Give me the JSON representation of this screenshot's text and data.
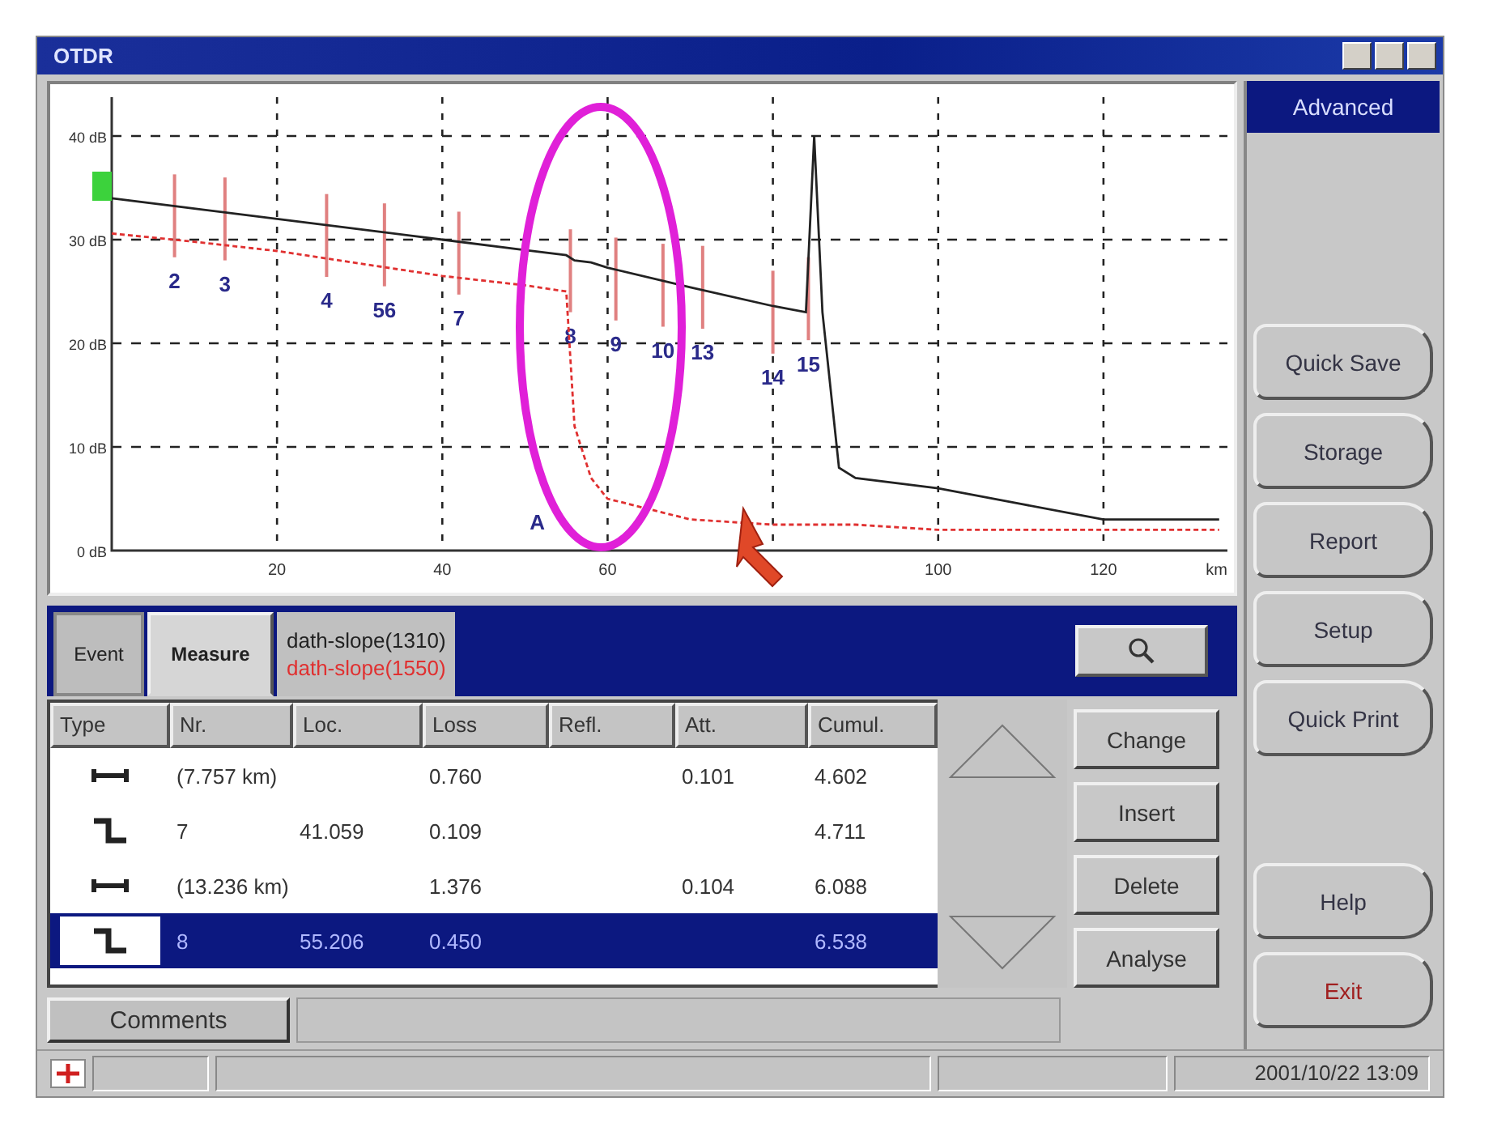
{
  "window": {
    "title": "OTDR"
  },
  "chart": {
    "chart_data": {
      "type": "line",
      "xlabel": "km",
      "grid": true,
      "x": [
        0,
        10,
        20,
        30,
        40,
        50,
        55,
        56,
        58,
        60,
        70,
        80,
        84,
        85,
        86,
        88,
        90,
        100,
        110,
        120,
        134
      ],
      "series": [
        {
          "name": "dath-slope(1310)",
          "color": "#222222",
          "line_style": "solid",
          "values": [
            34,
            33,
            32,
            31,
            30,
            29,
            28.5,
            28,
            27.8,
            27.3,
            25.4,
            23.6,
            23,
            40,
            23,
            8,
            7,
            6,
            4.5,
            3,
            3
          ]
        },
        {
          "name": "dath-slope(1550)",
          "color": "#e03030",
          "line_style": "dashed",
          "values": [
            30.6,
            29.8,
            28.9,
            27.7,
            26.5,
            25.6,
            25,
            12,
            7,
            5,
            3,
            2.5,
            2.5,
            2.5,
            2.5,
            2.5,
            2.5,
            2,
            2,
            2,
            2
          ]
        }
      ],
      "xlim": [
        0,
        135
      ],
      "ylim": [
        0,
        43.75
      ],
      "xticks": [
        20,
        40,
        60,
        100,
        120
      ],
      "yticks": [
        {
          "value": 0,
          "label": "0 dB"
        },
        {
          "value": 10,
          "label": "10 dB"
        },
        {
          "value": 20,
          "label": "20 dB"
        },
        {
          "value": 30,
          "label": "30 dB"
        },
        {
          "value": 40,
          "label": "40 dB"
        }
      ],
      "annotations": [
        "2",
        "3",
        "4",
        "56",
        "7",
        "8",
        "9",
        "10",
        "13",
        "14",
        "15",
        "A"
      ]
    }
  },
  "side_panel": {
    "title": "Advanced",
    "buttons": [
      "Quick Save",
      "Storage",
      "Report",
      "Setup",
      "Quick Print"
    ],
    "bottom_buttons": [
      "Help",
      "Exit"
    ]
  },
  "tabs": [
    {
      "label": "Event",
      "selected": false
    },
    {
      "label": "Measure",
      "selected": true
    }
  ],
  "table": {
    "columns": [
      "Type",
      "Nr.",
      "Loc.",
      "Loss",
      "Refl.",
      "Att.",
      "Cumul."
    ],
    "rows": [
      {
        "kind": "span",
        "selected": false,
        "cells": [
          "",
          "(7.757 km)",
          "",
          "0.760",
          "",
          "0.101",
          "4.602"
        ]
      },
      {
        "kind": "step",
        "selected": false,
        "cells": [
          "",
          "7",
          "41.059",
          "0.109",
          "",
          "",
          "4.711"
        ]
      },
      {
        "kind": "span",
        "selected": false,
        "cells": [
          "",
          "(13.236 km)",
          "",
          "1.376",
          "",
          "0.104",
          "6.088"
        ]
      },
      {
        "kind": "step",
        "selected": true,
        "cells": [
          "",
          "8",
          "55.206",
          "0.450",
          "",
          "",
          "6.538"
        ]
      }
    ]
  },
  "actions": [
    "Change",
    "Insert",
    "Delete",
    "Analyse"
  ],
  "comments_button": "Comments",
  "status_bar": {
    "time": "2001/10/22 13:09"
  }
}
